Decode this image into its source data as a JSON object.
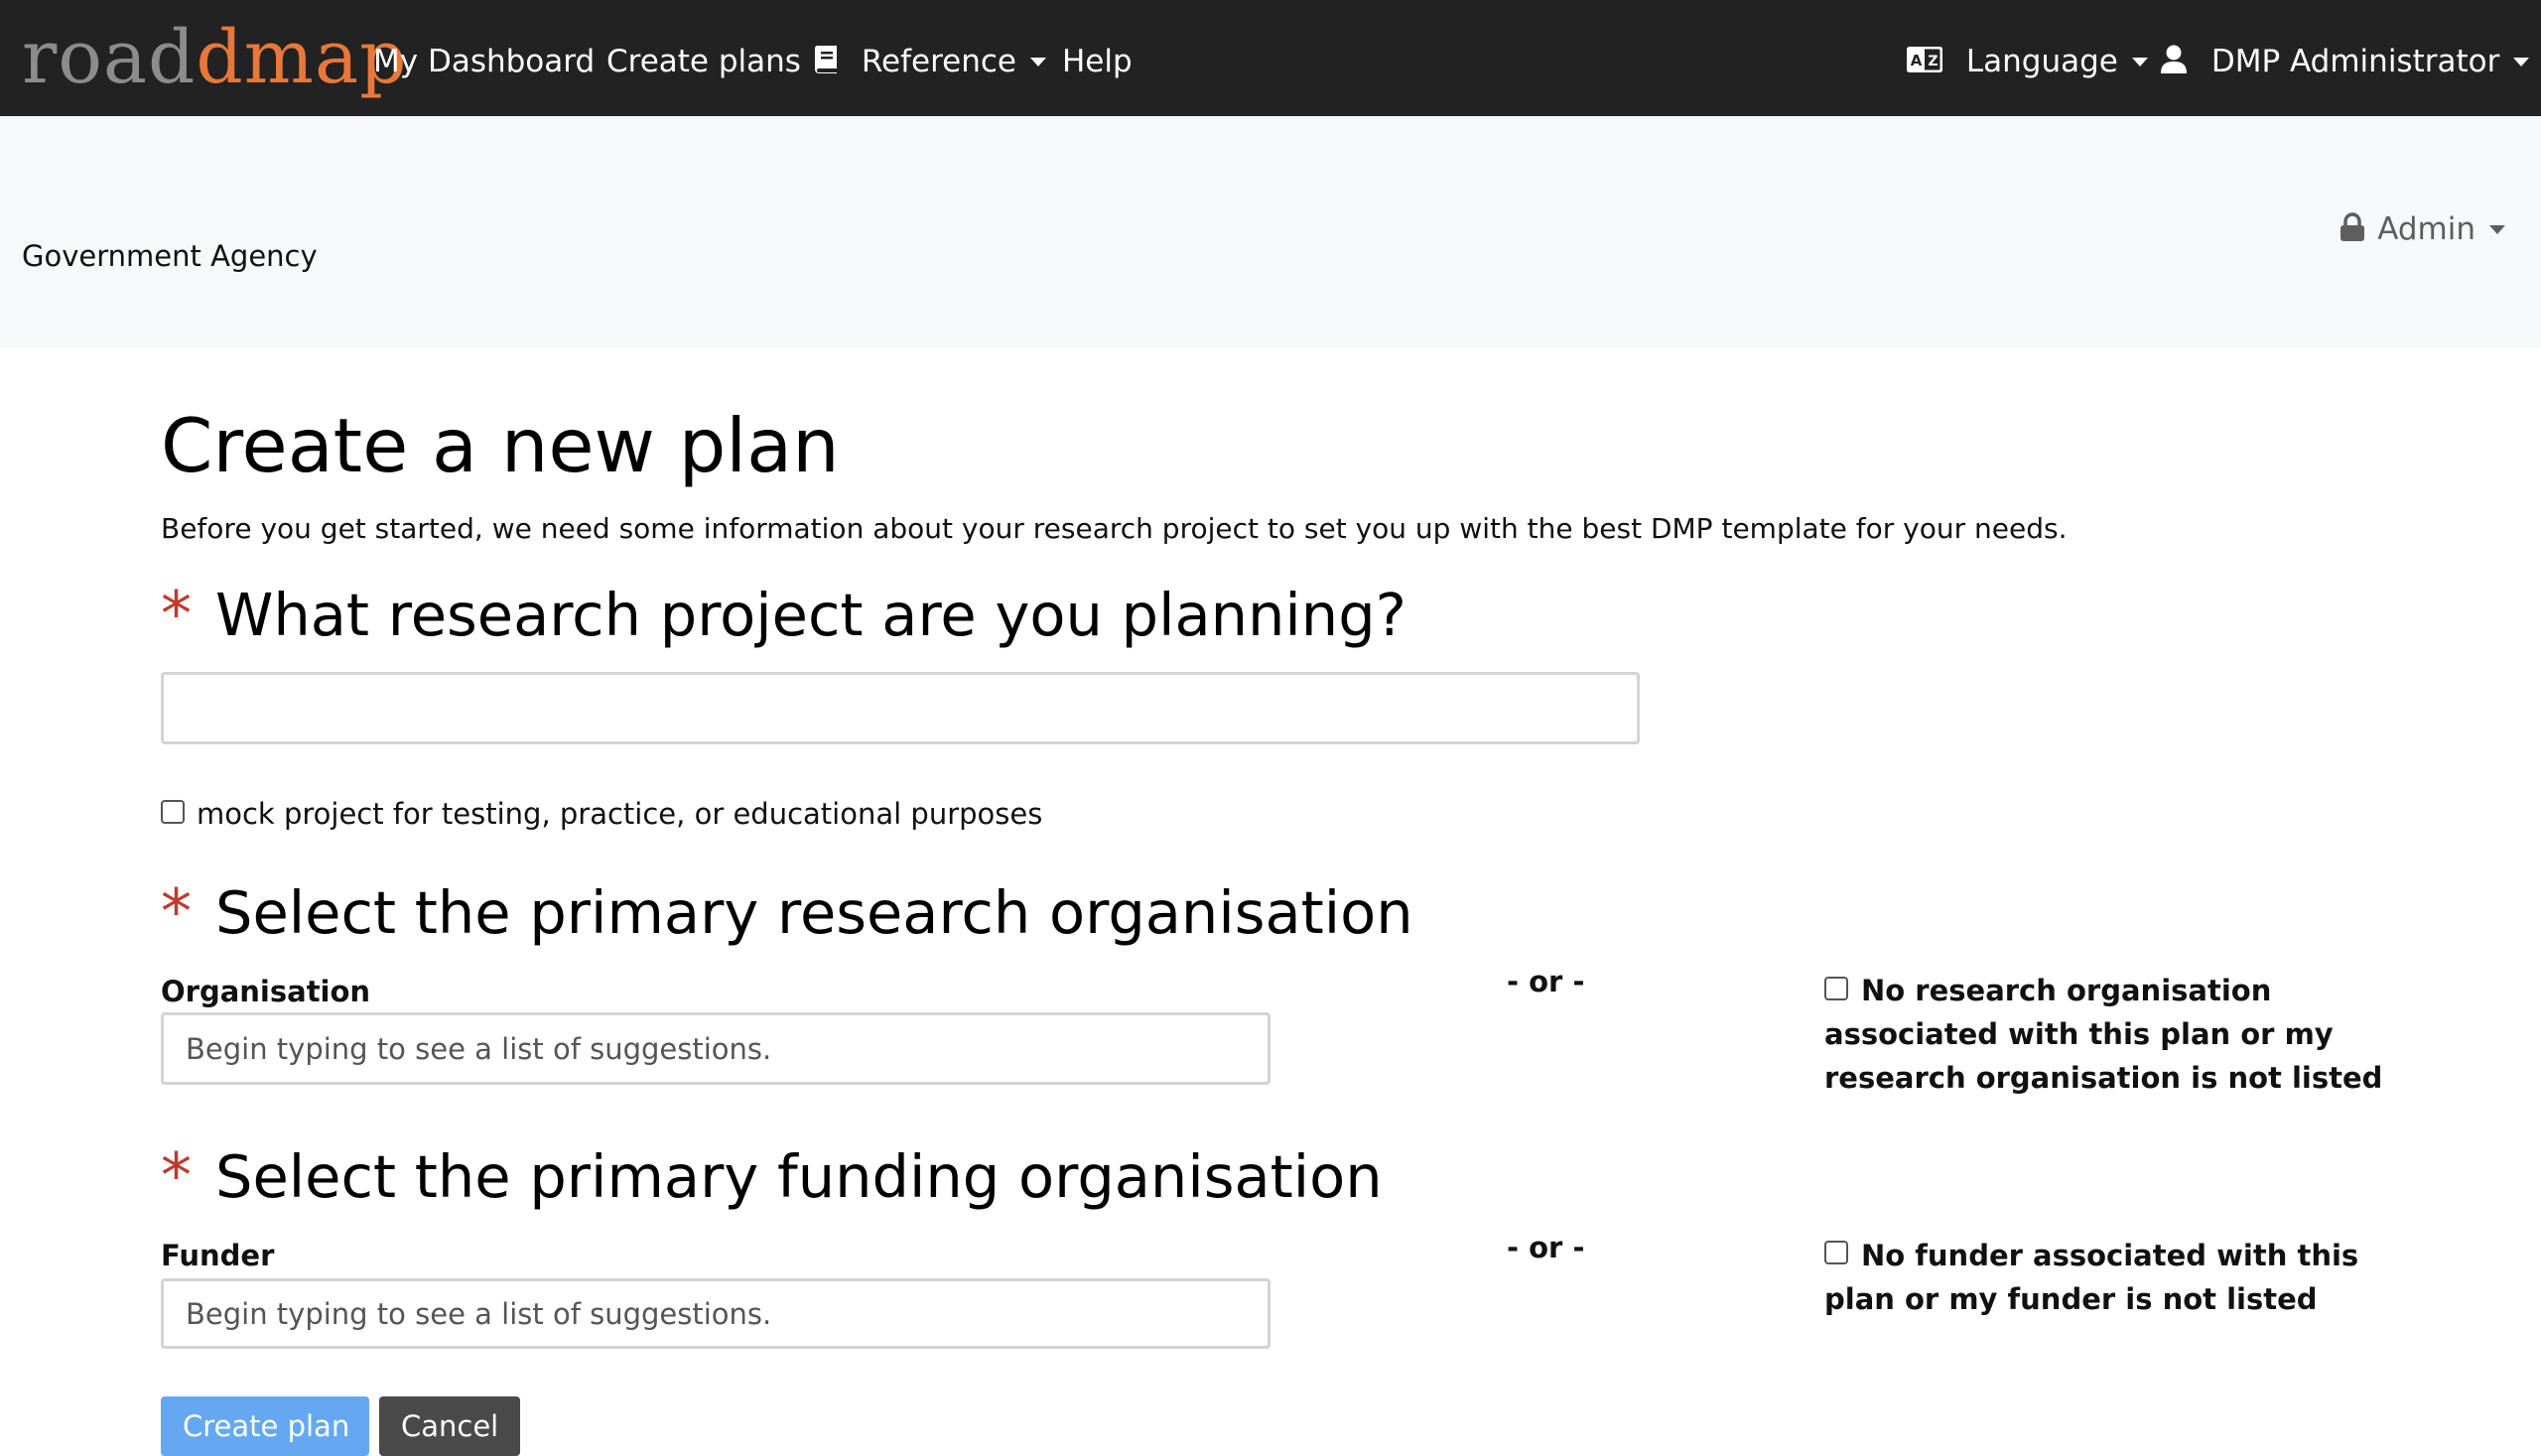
{
  "navbar": {
    "logo_part1": "road",
    "logo_part2": "dmap",
    "links": {
      "dashboard": "My Dashboard",
      "create_plans": "Create plans",
      "reference": "Reference",
      "help": "Help"
    },
    "language": "Language",
    "user": "DMP Administrator",
    "icons": [
      "book-icon",
      "language-icon",
      "user-icon"
    ]
  },
  "org_bar": {
    "org_name": "Government Agency",
    "admin_menu": "Admin",
    "icons": [
      "lock-icon"
    ]
  },
  "form": {
    "title": "Create a new plan",
    "intro": "Before you get started, we need some information about your research project to set you up with the best DMP template for your needs.",
    "project": {
      "required_mark": "*",
      "heading": "What research project are you planning?",
      "value": "",
      "mock_label": "mock project for testing, practice, or educational purposes",
      "mock_checked": false
    },
    "research_org": {
      "required_mark": "*",
      "heading": "Select the primary research organisation",
      "field_label": "Organisation",
      "placeholder": "Begin typing to see a list of suggestions.",
      "or": "- or -",
      "none_label": "No research organisation associated with this plan or my research organisation is not listed",
      "none_checked": false
    },
    "funder": {
      "required_mark": "*",
      "heading": "Select the primary funding organisation",
      "field_label": "Funder",
      "placeholder": "Begin typing to see a list of suggestions.",
      "or": "- or -",
      "none_label": "No funder associated with this plan or my funder is not listed",
      "none_checked": false
    },
    "buttons": {
      "create": "Create plan",
      "cancel": "Cancel"
    }
  },
  "colors": {
    "navbar_bg": "#222222",
    "logo_road": "#8c8c8c",
    "logo_dmap": "#e8783a",
    "required": "#c0392b",
    "primary_button": "#65a8f2",
    "cancel_button": "#4a4a4a",
    "org_bar_bg": "#f7f8fa"
  }
}
